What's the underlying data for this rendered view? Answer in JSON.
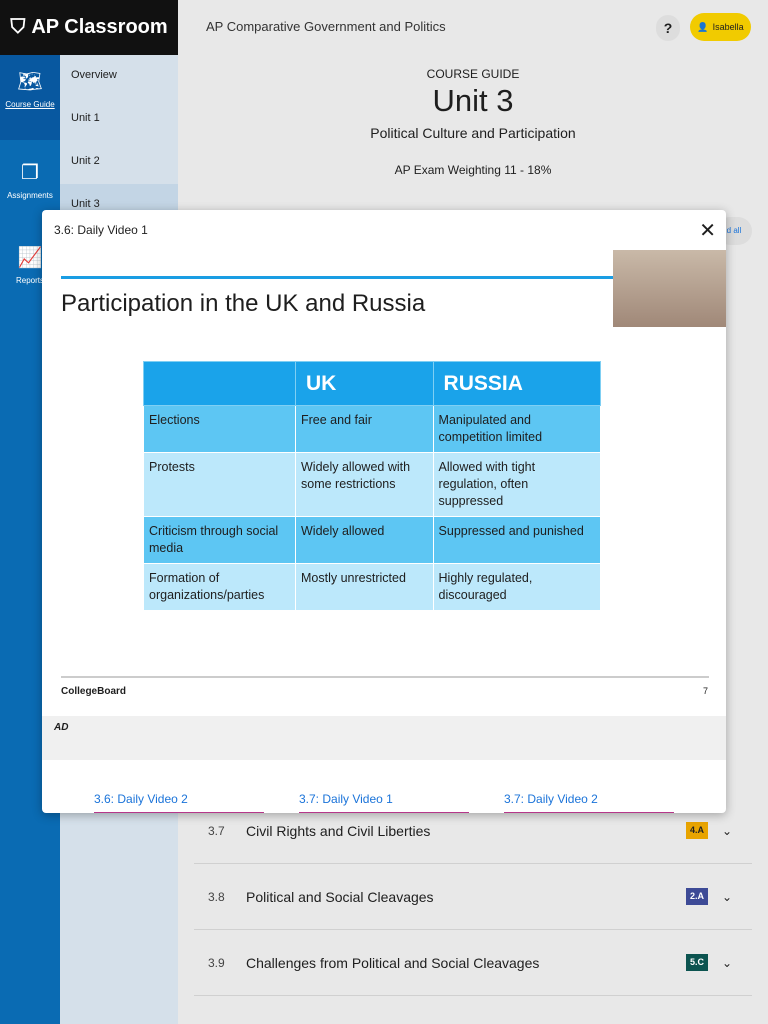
{
  "header": {
    "logo": "AP Classroom",
    "course": "AP Comparative Government and Politics",
    "help": "?",
    "user": "Isabella"
  },
  "rail": [
    {
      "label": "Course Guide",
      "icon": "map-icon"
    },
    {
      "label": "Assignments",
      "icon": "copy-icon"
    },
    {
      "label": "Reports",
      "icon": "chart-icon"
    }
  ],
  "nav": [
    "Overview",
    "Unit 1",
    "Unit 2",
    "Unit 3"
  ],
  "guide": {
    "eyebrow": "COURSE GUIDE",
    "unit": "Unit 3",
    "subtitle": "Political Culture and Participation",
    "weighting": "AP Exam Weighting 11 - 18%",
    "expand": "d all"
  },
  "sections": [
    {
      "num": "3.7",
      "title": "Civil Rights and Civil Liberties",
      "badge": "4.A",
      "color": "#e8a400"
    },
    {
      "num": "3.8",
      "title": "Political and Social Cleavages",
      "badge": "2.A",
      "color": "#3d4a96"
    },
    {
      "num": "3.9",
      "title": "Challenges from Political and Social Cleavages",
      "badge": "5.C",
      "color": "#0c5450"
    }
  ],
  "modal": {
    "title": "3.6: Daily Video 1",
    "close": "✕",
    "slide": {
      "title": "Participation in the UK and Russia",
      "headers": [
        "",
        "UK",
        "RUSSIA"
      ],
      "rows": [
        [
          "Elections",
          "Free and fair",
          "Manipulated and competition limited"
        ],
        [
          "Protests",
          "Widely allowed with some restrictions",
          "Allowed with tight regulation, often suppressed"
        ],
        [
          "Criticism through social media",
          "Widely allowed",
          "Suppressed and punished"
        ],
        [
          "Formation of organizations/parties",
          "Mostly unrestricted",
          "Highly regulated, discouraged"
        ]
      ],
      "footer": "CollegeBoard",
      "page": "7"
    },
    "player_logo": "AD",
    "tabs": [
      "3.6: Daily Video 2",
      "3.7: Daily Video 1",
      "3.7: Daily Video 2"
    ]
  }
}
